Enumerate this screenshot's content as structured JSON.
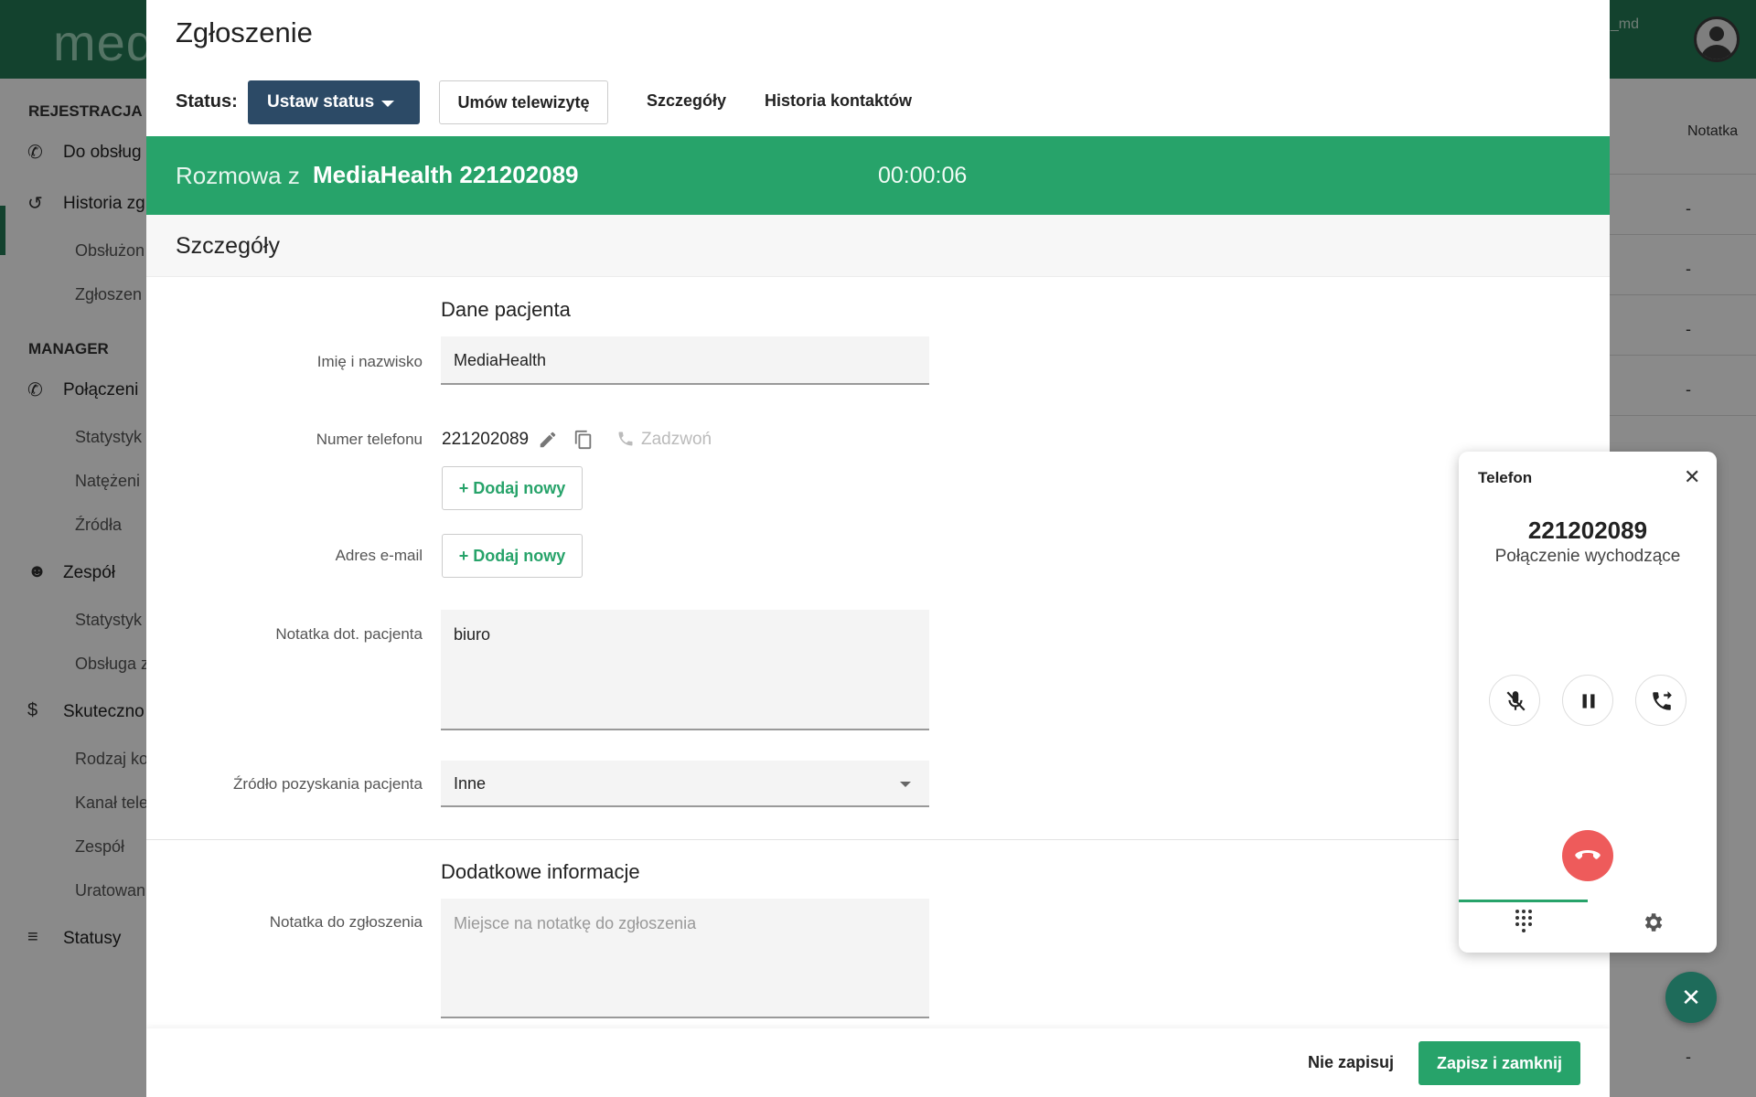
{
  "app": {
    "logo": "med",
    "user_fragment": "g_md",
    "sidebar": {
      "section_registration": "REJESTRACJA",
      "item_todo": "Do obsług",
      "item_history": "Historia zg",
      "sub_handled": "Obsłużon",
      "sub_reports": "Zgłoszen",
      "section_manager": "MANAGER",
      "item_calls": "Połączeni",
      "sub_stats": "Statystyk",
      "sub_intensity": "Natężeni",
      "sub_sources": "Źródła",
      "item_team": "Zespół",
      "sub_team_stats": "Statystyk",
      "sub_handling": "Obsługa z",
      "item_effectiveness": "Skuteczno",
      "sub_kind": "Rodzaj ko",
      "sub_channel": "Kanał tele",
      "sub_team": "Zespół",
      "sub_saved": "Uratowan",
      "item_statuses": "Statusy"
    },
    "right_column": "Notatka",
    "right_dash": "-"
  },
  "modal": {
    "title": "Zgłoszenie",
    "status_label": "Status:",
    "set_status_button": "Ustaw status",
    "televisit_button": "Umów telewizytę",
    "tab_details": "Szczegóły",
    "tab_contacts": "Historia kontaktów",
    "call": {
      "prefix": "Rozmowa z",
      "name": "MediaHealth 221202089",
      "timer": "00:00:06"
    },
    "section_title": "Szczegóły",
    "patient_group": "Dane pacjenta",
    "labels": {
      "name": "Imię i nazwisko",
      "phone": "Numer telefonu",
      "email": "Adres e-mail",
      "patient_note": "Notatka dot. pacjenta",
      "source": "Źródło pozyskania pacjenta",
      "report_note": "Notatka do zgłoszenia"
    },
    "name_value": "MediaHealth",
    "phone_value": "221202089",
    "call_link": "Zadzwoń",
    "add_new": "+ Dodaj nowy",
    "patient_note_value": "biuro",
    "source_value": "Inne",
    "extra_group": "Dodatkowe informacje",
    "report_note_placeholder": "Miejsce na notatkę do zgłoszenia",
    "no_save_button": "Nie zapisuj",
    "save_button": "Zapisz i zamknij"
  },
  "phone_widget": {
    "title": "Telefon",
    "number": "221202089",
    "state": "Połączenie wychodzące"
  },
  "colors": {
    "brand_green": "#27a36a",
    "header_green": "#237a55",
    "status_button": "#2c4a66",
    "hangup_red": "#ee5b5b"
  },
  "icons": [
    "phone-icon",
    "history-icon",
    "people-icon",
    "dollar-icon",
    "sort-icon",
    "pencil-icon",
    "copy-icon",
    "mic-off-icon",
    "pause-icon",
    "transfer-icon",
    "hangup-icon",
    "dialpad-icon",
    "gear-icon",
    "close-icon"
  ]
}
